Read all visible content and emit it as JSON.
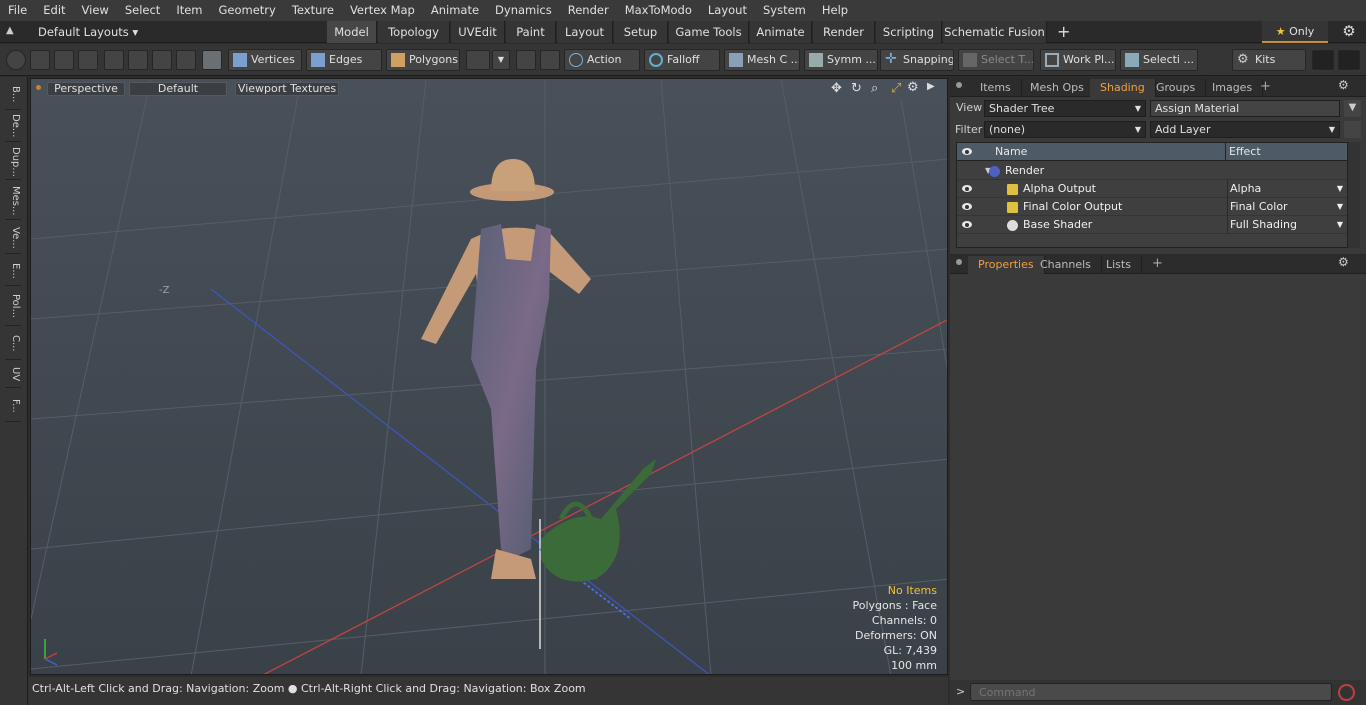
{
  "menu": [
    "File",
    "Edit",
    "View",
    "Select",
    "Item",
    "Geometry",
    "Texture",
    "Vertex Map",
    "Animate",
    "Dynamics",
    "Render",
    "MaxToModo",
    "Layout",
    "System",
    "Help"
  ],
  "layouts": {
    "label": "Default Layouts ▾"
  },
  "mode_tabs": [
    "Model",
    "Topology",
    "UVEdit",
    "Paint",
    "Layout",
    "Setup",
    "Game Tools",
    "Animate",
    "Render",
    "Scripting",
    "Schematic Fusion"
  ],
  "mode_active": "Model",
  "mode_plus": "+",
  "only_label": "Only",
  "toolbar": {
    "vertices": "Vertices",
    "edges": "Edges",
    "polygons": "Polygons",
    "action": "Action",
    "falloff": "Falloff",
    "mesh_c": "Mesh C ...",
    "symm": "Symm ...",
    "snapping": "Snapping",
    "select_t": "Select T...",
    "work_pl": "Work Pl...",
    "selecti": "Selecti ...",
    "kits": "Kits"
  },
  "left_tabs": [
    "B...",
    "De...",
    "Dup...",
    "Mes...",
    "Ve...",
    "E...",
    "Pol...",
    "C...",
    "UV",
    "F..."
  ],
  "viewport": {
    "perspective": "Perspective",
    "default": "Default",
    "textures": "Viewport Textures",
    "axis_label": "-Z",
    "stats": {
      "items": "No Items",
      "polygons": "Polygons : Face",
      "channels": "Channels: 0",
      "deformers": "Deformers: ON",
      "gl": "GL: 7,439",
      "scale": "100 mm"
    }
  },
  "status": "Ctrl-Alt-Left Click and Drag: Navigation: Zoom ● Ctrl-Alt-Right Click and Drag: Navigation: Box Zoom",
  "panel": {
    "tabs": [
      "Items",
      "Mesh Ops",
      "Shading",
      "Groups",
      "Images"
    ],
    "active_tab": "Shading",
    "view_label": "View",
    "view_value": "Shader Tree",
    "assign": "Assign Material",
    "filter_label": "Filter",
    "filter_value": "(none)",
    "add_layer": "Add Layer",
    "col_name": "Name",
    "col_effect": "Effect",
    "rows": [
      {
        "name": "Render",
        "effect": ""
      },
      {
        "name": "Alpha Output",
        "effect": "Alpha"
      },
      {
        "name": "Final Color Output",
        "effect": "Final Color"
      },
      {
        "name": "Base Shader",
        "effect": "Full Shading"
      }
    ],
    "lower_tabs": [
      "Properties",
      "Channels",
      "Lists"
    ],
    "lower_active": "Properties",
    "command_placeholder": "Command"
  },
  "colors": {
    "accent": "#f0a040",
    "grid_red": "#c0453f",
    "grid_blue": "#3d56b8",
    "background": "#414a52"
  }
}
